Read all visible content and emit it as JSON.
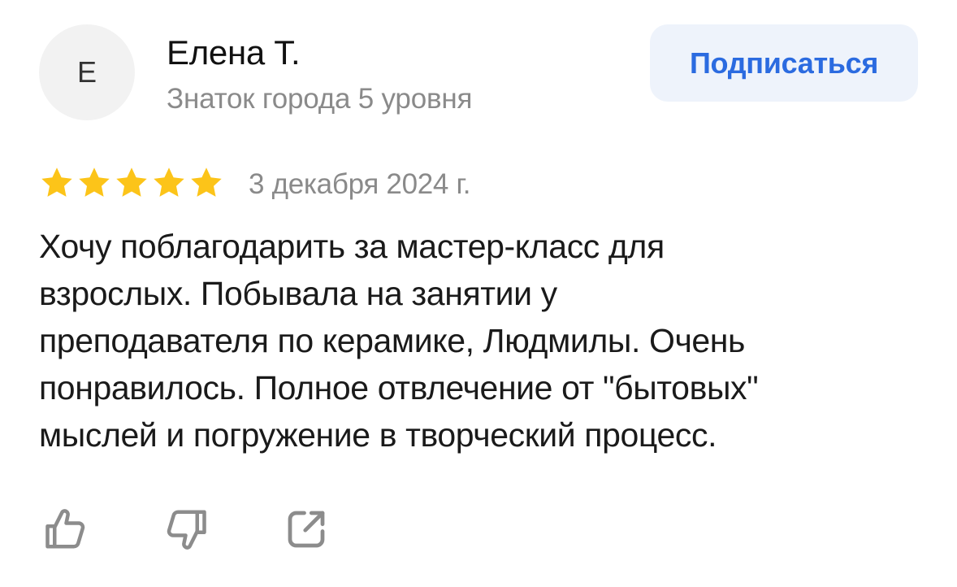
{
  "author": {
    "avatar_letter": "Е",
    "name": "Елена Т.",
    "level": "Знаток города 5 уровня"
  },
  "subscribe_label": "Подписаться",
  "review": {
    "rating": 5,
    "rating_max": 5,
    "date": "3 декабря 2024 г.",
    "text": "Хочу поблагодарить за мастер-класс для\nвзрослых. Побывала на занятии у\nпреподавателя по керамике, Людмилы. Очень\nпонравилось. Полное отвлечение от \"бытовых\"\nмыслей и погружение в творческий процесс."
  },
  "actions": [
    {
      "icon": "thumbs-up-icon"
    },
    {
      "icon": "thumbs-down-icon"
    },
    {
      "icon": "share-icon"
    }
  ],
  "colors": {
    "star": "#fcc419",
    "accent": "#2b6be0",
    "button_bg": "#eef3fb",
    "muted_text": "#8a8a8a",
    "icon_stroke": "#8c8c8c"
  }
}
